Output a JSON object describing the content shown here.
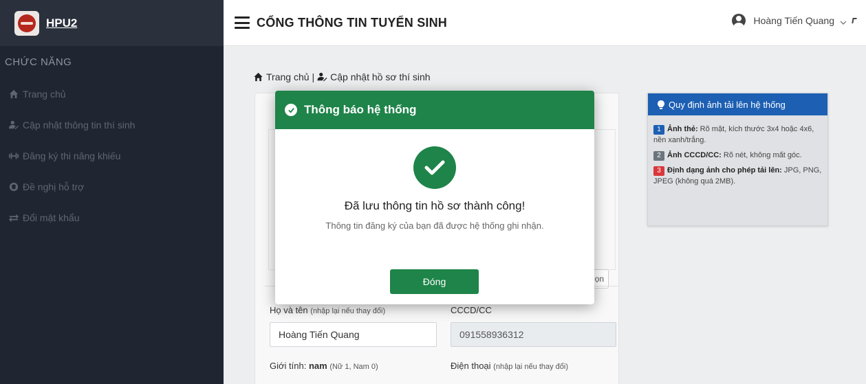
{
  "sidebar": {
    "brand": "HPU2",
    "menu_header": "CHỨC NĂNG",
    "items": [
      {
        "label": "Trang chủ",
        "icon": "home-icon"
      },
      {
        "label": "Cập nhật thông tin thí sinh",
        "icon": "user-edit-icon"
      },
      {
        "label": "Đăng ký thi năng khiếu",
        "icon": "dumbbell-icon"
      },
      {
        "label": "Đề nghị hỗ trợ",
        "icon": "support-icon"
      },
      {
        "label": "Đổi mật khẩu",
        "icon": "exchange-icon"
      }
    ]
  },
  "topbar": {
    "title": "CỔNG THÔNG TIN TUYỂN SINH",
    "user_name": "Hoàng Tiến Quang"
  },
  "breadcrumb": {
    "home": "Trang chủ",
    "separator": "|",
    "current": "Cập nhật hồ sơ thí sinh"
  },
  "form": {
    "partial_button": "ọn",
    "name_label": "Họ và tên",
    "name_hint": "(nhập lại nếu thay đổi)",
    "name_value": "Hoàng Tiến Quang",
    "id_label": "CCCD/CC",
    "id_value": "091558936312",
    "gender_label": "Giới tính:",
    "gender_value": "nam",
    "gender_hint": "(Nữ 1, Nam 0)",
    "phone_label": "Điện thoại",
    "phone_hint": "(nhập lại nếu thay đổi)"
  },
  "info": {
    "title": "Quy định ảnh tải lên hệ thống",
    "rules": [
      {
        "num": "1",
        "title": "Ảnh thẻ:",
        "text": "Rõ mặt, kích thước 3x4 hoặc 4x6, nền xanh/trắng."
      },
      {
        "num": "2",
        "title": "Ảnh CCCD/CC:",
        "text": "Rõ nét, không mất góc."
      },
      {
        "num": "3",
        "title": "Định dạng ảnh cho phép tải lên:",
        "text": "JPG, PNG, JPEG (không quá 2MB)."
      }
    ]
  },
  "modal": {
    "title": "Thông báo hệ thống",
    "message": "Đã lưu thông tin hồ sơ thành công!",
    "sub": "Thông tin đăng ký của bạn đã được hệ thống ghi nhận.",
    "close_label": "Đóng"
  },
  "colors": {
    "sidebar_bg": "#1f2632",
    "success_green": "#1e8449",
    "info_blue": "#1c5fb3",
    "badge_red": "#d9383c",
    "badge_gray": "#6c757d"
  }
}
